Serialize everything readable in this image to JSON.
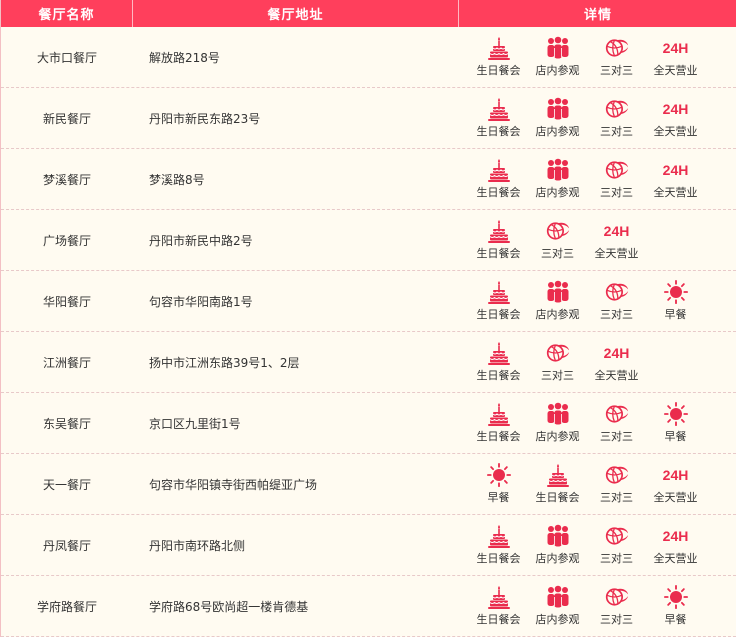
{
  "colors": {
    "header_bg": "#ff3f5c",
    "row_bg": "#fffbf1",
    "accent": "#ea2c4d"
  },
  "header": {
    "name": "餐厅名称",
    "address": "餐厅地址",
    "details": "详情"
  },
  "features": {
    "birthday": {
      "label": "生日餐会",
      "icon": "birthday-cake-icon"
    },
    "tour": {
      "label": "店内参观",
      "icon": "group-tour-icon"
    },
    "basketball": {
      "label": "三对三",
      "icon": "basketball-icon"
    },
    "allday": {
      "label": "全天营业",
      "icon": "24h-icon",
      "badge": "24H"
    },
    "breakfast": {
      "label": "早餐",
      "icon": "sun-icon"
    }
  },
  "rows": [
    {
      "name": "大市口餐厅",
      "address": "解放路218号",
      "features": [
        "birthday",
        "tour",
        "basketball",
        "allday"
      ]
    },
    {
      "name": "新民餐厅",
      "address": "丹阳市新民东路23号",
      "features": [
        "birthday",
        "tour",
        "basketball",
        "allday"
      ]
    },
    {
      "name": "梦溪餐厅",
      "address": "梦溪路8号",
      "features": [
        "birthday",
        "tour",
        "basketball",
        "allday"
      ]
    },
    {
      "name": "广场餐厅",
      "address": "丹阳市新民中路2号",
      "features": [
        "birthday",
        "basketball",
        "allday"
      ]
    },
    {
      "name": "华阳餐厅",
      "address": "句容市华阳南路1号",
      "features": [
        "birthday",
        "tour",
        "basketball",
        "breakfast"
      ]
    },
    {
      "name": "江洲餐厅",
      "address": "扬中市江洲东路39号1、2层",
      "features": [
        "birthday",
        "basketball",
        "allday"
      ]
    },
    {
      "name": "东吴餐厅",
      "address": "京口区九里街1号",
      "features": [
        "birthday",
        "tour",
        "basketball",
        "breakfast"
      ]
    },
    {
      "name": "天一餐厅",
      "address": "句容市华阳镇寺街西帕缇亚广场",
      "features": [
        "breakfast",
        "birthday",
        "basketball",
        "allday"
      ]
    },
    {
      "name": "丹凤餐厅",
      "address": "丹阳市南环路北侧",
      "features": [
        "birthday",
        "tour",
        "basketball",
        "allday"
      ]
    },
    {
      "name": "学府路餐厅",
      "address": "学府路68号欧尚超一楼肯德基",
      "features": [
        "birthday",
        "tour",
        "basketball",
        "breakfast"
      ]
    }
  ]
}
